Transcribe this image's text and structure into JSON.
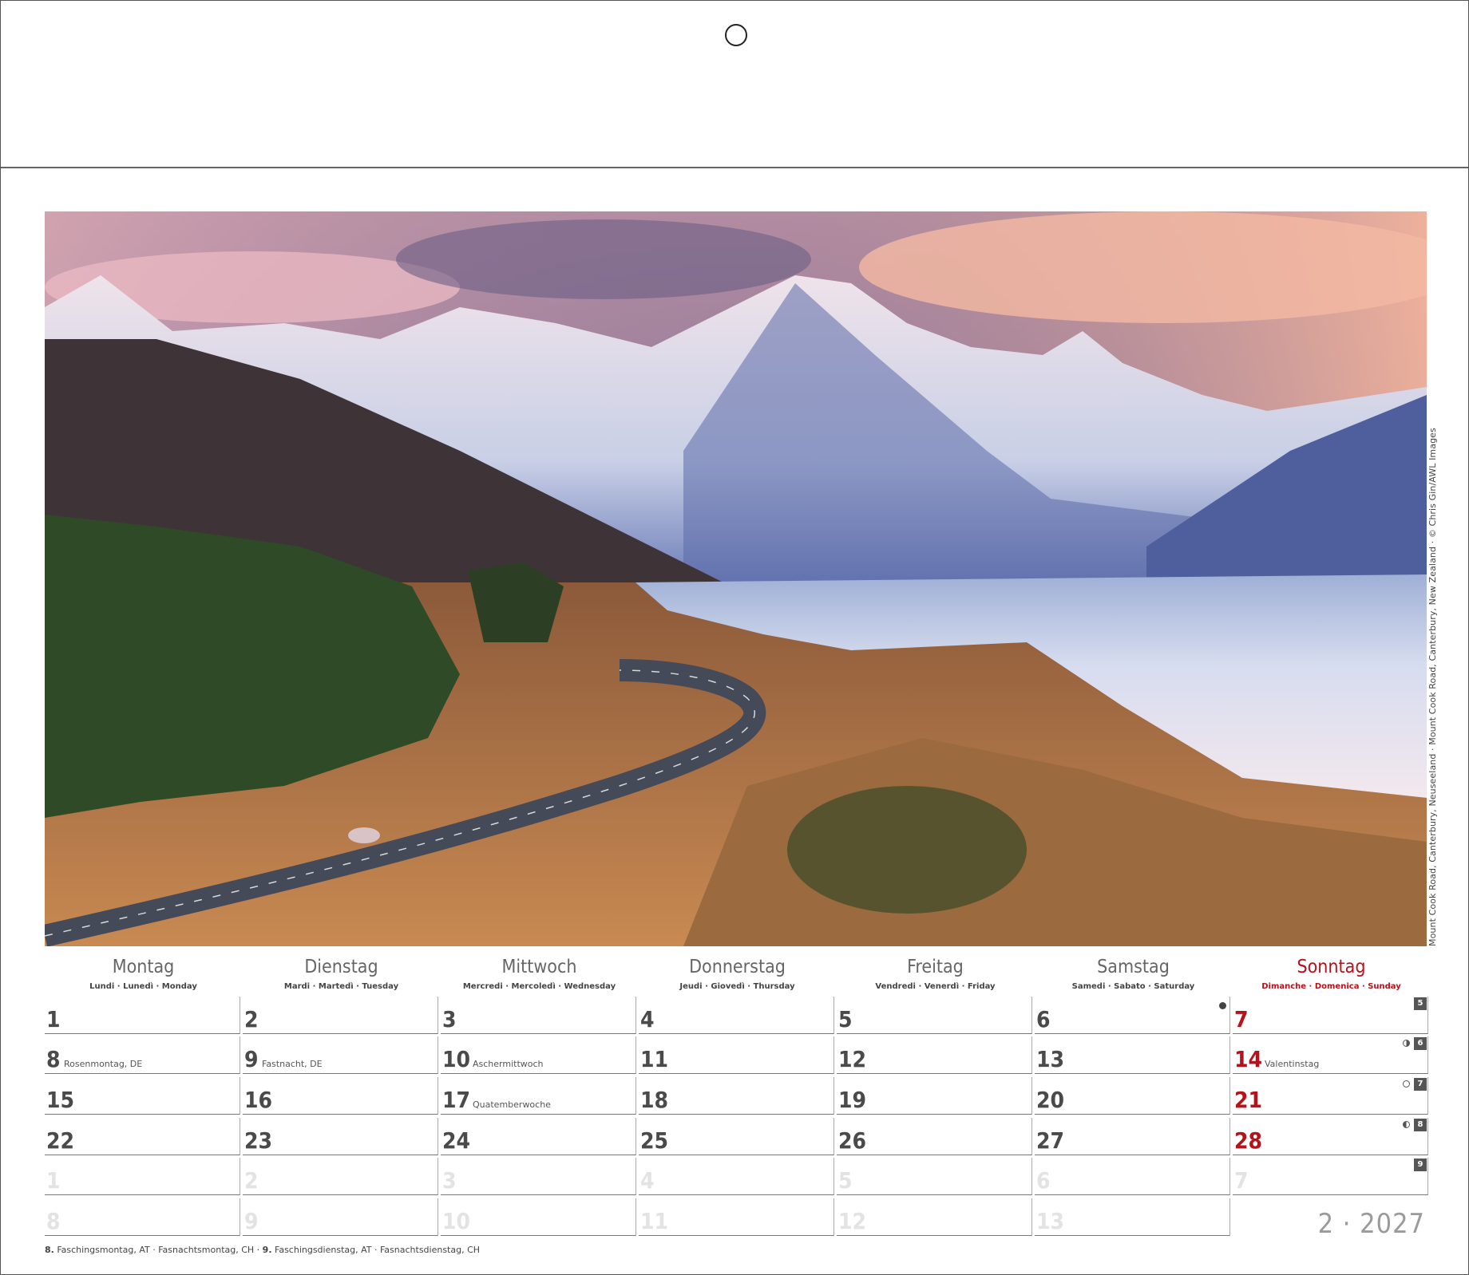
{
  "photo": {
    "credit": "Mount Cook Road, Canterbury, Neuseeland · Mount Cook Road, Canterbury, New Zealand · © Chris Gin/AWL Images"
  },
  "weekdays": [
    {
      "name": "Montag",
      "sub": "Lundi · Lunedì · Monday"
    },
    {
      "name": "Dienstag",
      "sub": "Mardi · Martedì · Tuesday"
    },
    {
      "name": "Mittwoch",
      "sub": "Mercredi · Mercoledì · Wednesday"
    },
    {
      "name": "Donnerstag",
      "sub": "Jeudi · Giovedì · Thursday"
    },
    {
      "name": "Freitag",
      "sub": "Vendredi · Venerdì · Friday"
    },
    {
      "name": "Samstag",
      "sub": "Samedi · Sabato · Saturday"
    },
    {
      "name": "Sonntag",
      "sub": "Dimanche · Domenica · Sunday"
    }
  ],
  "weeks": [
    {
      "kw": "5",
      "days": [
        {
          "num": "1"
        },
        {
          "num": "2"
        },
        {
          "num": "3"
        },
        {
          "num": "4"
        },
        {
          "num": "5"
        },
        {
          "num": "6",
          "moon": "new"
        },
        {
          "num": "7"
        }
      ]
    },
    {
      "kw": "6",
      "days": [
        {
          "num": "8",
          "note": "Rosenmontag, DE"
        },
        {
          "num": "9",
          "note": "Fastnacht, DE"
        },
        {
          "num": "10",
          "note": "Aschermittwoch"
        },
        {
          "num": "11"
        },
        {
          "num": "12"
        },
        {
          "num": "13"
        },
        {
          "num": "14",
          "note": "Valentinstag",
          "moon": "first"
        }
      ]
    },
    {
      "kw": "7",
      "days": [
        {
          "num": "15"
        },
        {
          "num": "16"
        },
        {
          "num": "17",
          "note": "Quatemberwoche"
        },
        {
          "num": "18"
        },
        {
          "num": "19"
        },
        {
          "num": "20"
        },
        {
          "num": "21",
          "moon": "full"
        }
      ]
    },
    {
      "kw": "8",
      "days": [
        {
          "num": "22"
        },
        {
          "num": "23"
        },
        {
          "num": "24"
        },
        {
          "num": "25"
        },
        {
          "num": "26"
        },
        {
          "num": "27"
        },
        {
          "num": "28",
          "moon": "last"
        }
      ]
    },
    {
      "kw": "9",
      "faded": true,
      "days": [
        {
          "num": "1"
        },
        {
          "num": "2"
        },
        {
          "num": "3"
        },
        {
          "num": "4"
        },
        {
          "num": "5"
        },
        {
          "num": "6"
        },
        {
          "num": "7"
        }
      ]
    },
    {
      "kw": "",
      "faded": true,
      "days": [
        {
          "num": "8"
        },
        {
          "num": "9"
        },
        {
          "num": "10"
        },
        {
          "num": "11"
        },
        {
          "num": "12"
        },
        {
          "num": "13"
        }
      ]
    }
  ],
  "month_label": "2 · 2027",
  "footnote": [
    {
      "day": "8.",
      "text": " Faschingsmontag, AT  ·  Fasnachtsmontag, CH  ·  "
    },
    {
      "day": "9.",
      "text": " Faschingsdienstag, AT  ·  Fasnachtsdienstag, CH"
    }
  ]
}
